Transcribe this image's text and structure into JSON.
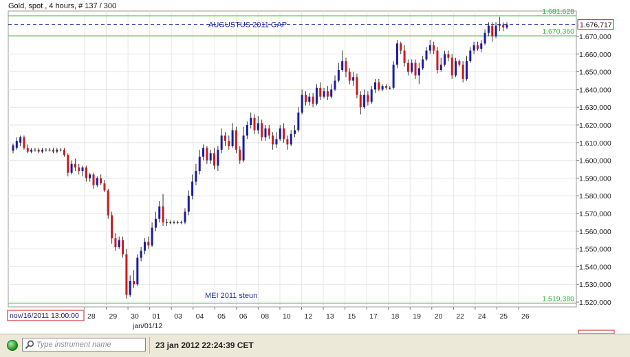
{
  "header": {
    "title": "Gold, spot , 4 hours, # 137 / 300"
  },
  "colors": {
    "up": "#1a1aa6",
    "down": "#cc1a1a",
    "flat": "#1a1a1a",
    "grid": "#e6e6e6",
    "level": "#2bbd2b",
    "dashed": "#1f2f9c",
    "accent": "#cc1a1a"
  },
  "chart_data": {
    "type": "candlestick",
    "title": "Gold, spot , 4 hours, # 137 / 300",
    "y_range": [
      1519380,
      1681628
    ],
    "y_ticks": [
      "1.520,000",
      "1.530,000",
      "1.540,000",
      "1.550,000",
      "1.560,000",
      "1.570,000",
      "1.580,000",
      "1.590,000",
      "1.600,000",
      "1.610,000",
      "1.620,000",
      "1.630,000",
      "1.640,000",
      "1.650,000",
      "1.660,000",
      "1.670,000"
    ],
    "y_tick_values": [
      1520000,
      1530000,
      1540000,
      1550000,
      1560000,
      1570000,
      1580000,
      1590000,
      1600000,
      1610000,
      1620000,
      1630000,
      1640000,
      1650000,
      1660000,
      1670000
    ],
    "x_labels": [
      "28",
      "29",
      "30",
      "01",
      "03",
      "04",
      "05",
      "06",
      "08",
      "10",
      "12",
      "13",
      "15",
      "17",
      "18",
      "19",
      "20",
      "22",
      "24",
      "25",
      "26"
    ],
    "x_sublabel": "jan/01/12",
    "crosshair_date": "nov/16/2011 13:00:00",
    "current_price": "1.676,717",
    "current_value": 1676717,
    "levels": [
      {
        "label": "1.681,628",
        "value": 1681628
      },
      {
        "label": "1.670,360",
        "value": 1670360
      },
      {
        "label": "1.519,380",
        "value": 1519380
      }
    ],
    "annotations": [
      {
        "text": "AUGUSTUS 2011 GAP",
        "value": 1676717
      },
      {
        "text": "MEI 2011 steun",
        "value": 1525000
      }
    ],
    "candles": [
      {
        "o": 1605500,
        "c": 1608500,
        "h": 1609500,
        "l": 1604000
      },
      {
        "o": 1607000,
        "c": 1611000,
        "h": 1613000,
        "l": 1606000
      },
      {
        "o": 1610000,
        "c": 1613000,
        "h": 1614000,
        "l": 1608000
      },
      {
        "o": 1613000,
        "c": 1607000,
        "h": 1614000,
        "l": 1606000
      },
      {
        "o": 1607000,
        "c": 1605000,
        "h": 1609000,
        "l": 1604000
      },
      {
        "o": 1605000,
        "c": 1606000,
        "h": 1607000,
        "l": 1604000
      },
      {
        "o": 1606000,
        "c": 1606000,
        "h": 1607000,
        "l": 1605000
      },
      {
        "o": 1606000,
        "c": 1605000,
        "h": 1607000,
        "l": 1604000
      },
      {
        "o": 1605000,
        "c": 1606000,
        "h": 1607000,
        "l": 1604000
      },
      {
        "o": 1606000,
        "c": 1606000,
        "h": 1607000,
        "l": 1605000
      },
      {
        "o": 1606000,
        "c": 1606000,
        "h": 1607000,
        "l": 1605000
      },
      {
        "o": 1606000,
        "c": 1605000,
        "h": 1607000,
        "l": 1604000
      },
      {
        "o": 1605000,
        "c": 1606000,
        "h": 1607000,
        "l": 1604000
      },
      {
        "o": 1606000,
        "c": 1606000,
        "h": 1607000,
        "l": 1605000
      },
      {
        "o": 1606000,
        "c": 1603000,
        "h": 1607000,
        "l": 1602000
      },
      {
        "o": 1603000,
        "c": 1593000,
        "h": 1604000,
        "l": 1591000
      },
      {
        "o": 1593000,
        "c": 1598000,
        "h": 1600000,
        "l": 1592000
      },
      {
        "o": 1598000,
        "c": 1596000,
        "h": 1601000,
        "l": 1594000
      },
      {
        "o": 1596000,
        "c": 1594000,
        "h": 1598000,
        "l": 1592000
      },
      {
        "o": 1594000,
        "c": 1596000,
        "h": 1597000,
        "l": 1591000
      },
      {
        "o": 1596000,
        "c": 1590000,
        "h": 1597000,
        "l": 1588000
      },
      {
        "o": 1590000,
        "c": 1592000,
        "h": 1593000,
        "l": 1588000
      },
      {
        "o": 1592000,
        "c": 1586000,
        "h": 1593000,
        "l": 1584000
      },
      {
        "o": 1586000,
        "c": 1590000,
        "h": 1591000,
        "l": 1585000
      },
      {
        "o": 1590000,
        "c": 1587000,
        "h": 1592000,
        "l": 1586000
      },
      {
        "o": 1587000,
        "c": 1583000,
        "h": 1589000,
        "l": 1582000
      },
      {
        "o": 1583000,
        "c": 1569000,
        "h": 1584000,
        "l": 1567000
      },
      {
        "o": 1569000,
        "c": 1556000,
        "h": 1571000,
        "l": 1553000
      },
      {
        "o": 1556000,
        "c": 1551000,
        "h": 1559000,
        "l": 1549000
      },
      {
        "o": 1551000,
        "c": 1555000,
        "h": 1557000,
        "l": 1550000
      },
      {
        "o": 1555000,
        "c": 1547000,
        "h": 1557000,
        "l": 1545000
      },
      {
        "o": 1547000,
        "c": 1524000,
        "h": 1550000,
        "l": 1522000
      },
      {
        "o": 1524000,
        "c": 1532000,
        "h": 1535000,
        "l": 1523000
      },
      {
        "o": 1532000,
        "c": 1530000,
        "h": 1538000,
        "l": 1528000
      },
      {
        "o": 1530000,
        "c": 1545000,
        "h": 1547000,
        "l": 1529000
      },
      {
        "o": 1545000,
        "c": 1549000,
        "h": 1551000,
        "l": 1543000
      },
      {
        "o": 1549000,
        "c": 1554000,
        "h": 1556000,
        "l": 1547000
      },
      {
        "o": 1554000,
        "c": 1552000,
        "h": 1557000,
        "l": 1550000
      },
      {
        "o": 1552000,
        "c": 1562000,
        "h": 1565000,
        "l": 1551000
      },
      {
        "o": 1562000,
        "c": 1567000,
        "h": 1571000,
        "l": 1560000
      },
      {
        "o": 1567000,
        "c": 1574000,
        "h": 1577000,
        "l": 1565000
      },
      {
        "o": 1574000,
        "c": 1565000,
        "h": 1581000,
        "l": 1563000
      },
      {
        "o": 1565000,
        "c": 1565000,
        "h": 1567000,
        "l": 1563000
      },
      {
        "o": 1565000,
        "c": 1565000,
        "h": 1566000,
        "l": 1564000
      },
      {
        "o": 1565000,
        "c": 1565000,
        "h": 1566000,
        "l": 1564000
      },
      {
        "o": 1565000,
        "c": 1565000,
        "h": 1566000,
        "l": 1564000
      },
      {
        "o": 1565000,
        "c": 1565000,
        "h": 1566000,
        "l": 1564000
      },
      {
        "o": 1565000,
        "c": 1571000,
        "h": 1573000,
        "l": 1564000
      },
      {
        "o": 1571000,
        "c": 1580000,
        "h": 1583000,
        "l": 1569000
      },
      {
        "o": 1580000,
        "c": 1588000,
        "h": 1592000,
        "l": 1578000
      },
      {
        "o": 1588000,
        "c": 1594000,
        "h": 1598000,
        "l": 1586000
      },
      {
        "o": 1594000,
        "c": 1602000,
        "h": 1606000,
        "l": 1592000
      },
      {
        "o": 1602000,
        "c": 1607000,
        "h": 1609000,
        "l": 1600000
      },
      {
        "o": 1607000,
        "c": 1600000,
        "h": 1608000,
        "l": 1598000
      },
      {
        "o": 1600000,
        "c": 1604000,
        "h": 1606000,
        "l": 1598000
      },
      {
        "o": 1604000,
        "c": 1597000,
        "h": 1607000,
        "l": 1595000
      },
      {
        "o": 1597000,
        "c": 1606000,
        "h": 1608000,
        "l": 1594000
      },
      {
        "o": 1606000,
        "c": 1614000,
        "h": 1618000,
        "l": 1604000
      },
      {
        "o": 1614000,
        "c": 1611000,
        "h": 1616000,
        "l": 1608000
      },
      {
        "o": 1611000,
        "c": 1608000,
        "h": 1614000,
        "l": 1606000
      },
      {
        "o": 1608000,
        "c": 1617000,
        "h": 1621000,
        "l": 1607000
      },
      {
        "o": 1617000,
        "c": 1606000,
        "h": 1619000,
        "l": 1604000
      },
      {
        "o": 1606000,
        "c": 1600000,
        "h": 1608000,
        "l": 1598000
      },
      {
        "o": 1600000,
        "c": 1614000,
        "h": 1619000,
        "l": 1599000
      },
      {
        "o": 1614000,
        "c": 1620000,
        "h": 1622000,
        "l": 1612000
      },
      {
        "o": 1620000,
        "c": 1624000,
        "h": 1627000,
        "l": 1618000
      },
      {
        "o": 1624000,
        "c": 1617000,
        "h": 1626000,
        "l": 1615000
      },
      {
        "o": 1617000,
        "c": 1621000,
        "h": 1625000,
        "l": 1615000
      },
      {
        "o": 1621000,
        "c": 1613000,
        "h": 1623000,
        "l": 1611000
      },
      {
        "o": 1613000,
        "c": 1618000,
        "h": 1620000,
        "l": 1611000
      },
      {
        "o": 1618000,
        "c": 1614000,
        "h": 1620000,
        "l": 1612000
      },
      {
        "o": 1614000,
        "c": 1609000,
        "h": 1616000,
        "l": 1606000
      },
      {
        "o": 1609000,
        "c": 1612000,
        "h": 1616000,
        "l": 1607000
      },
      {
        "o": 1612000,
        "c": 1618000,
        "h": 1620000,
        "l": 1611000
      },
      {
        "o": 1618000,
        "c": 1612000,
        "h": 1621000,
        "l": 1610000
      },
      {
        "o": 1612000,
        "c": 1609000,
        "h": 1614000,
        "l": 1606000
      },
      {
        "o": 1609000,
        "c": 1615000,
        "h": 1617000,
        "l": 1608000
      },
      {
        "o": 1615000,
        "c": 1617000,
        "h": 1620000,
        "l": 1613000
      },
      {
        "o": 1617000,
        "c": 1627000,
        "h": 1630000,
        "l": 1616000
      },
      {
        "o": 1627000,
        "c": 1637000,
        "h": 1640000,
        "l": 1626000
      },
      {
        "o": 1637000,
        "c": 1633000,
        "h": 1639000,
        "l": 1631000
      },
      {
        "o": 1633000,
        "c": 1636000,
        "h": 1638000,
        "l": 1631000
      },
      {
        "o": 1636000,
        "c": 1632000,
        "h": 1638000,
        "l": 1630000
      },
      {
        "o": 1632000,
        "c": 1641000,
        "h": 1643000,
        "l": 1631000
      },
      {
        "o": 1641000,
        "c": 1636000,
        "h": 1644000,
        "l": 1634000
      },
      {
        "o": 1636000,
        "c": 1639000,
        "h": 1641000,
        "l": 1635000
      },
      {
        "o": 1639000,
        "c": 1636000,
        "h": 1642000,
        "l": 1634000
      },
      {
        "o": 1636000,
        "c": 1640000,
        "h": 1643000,
        "l": 1635000
      },
      {
        "o": 1640000,
        "c": 1645000,
        "h": 1648000,
        "l": 1639000
      },
      {
        "o": 1645000,
        "c": 1651000,
        "h": 1655000,
        "l": 1644000
      },
      {
        "o": 1651000,
        "c": 1656000,
        "h": 1662000,
        "l": 1650000
      },
      {
        "o": 1656000,
        "c": 1650000,
        "h": 1658000,
        "l": 1647000
      },
      {
        "o": 1650000,
        "c": 1645000,
        "h": 1652000,
        "l": 1643000
      },
      {
        "o": 1645000,
        "c": 1647000,
        "h": 1650000,
        "l": 1642000
      },
      {
        "o": 1647000,
        "c": 1637000,
        "h": 1649000,
        "l": 1635000
      },
      {
        "o": 1637000,
        "c": 1630000,
        "h": 1639000,
        "l": 1626000
      },
      {
        "o": 1630000,
        "c": 1637000,
        "h": 1640000,
        "l": 1629000
      },
      {
        "o": 1637000,
        "c": 1633000,
        "h": 1639000,
        "l": 1631000
      },
      {
        "o": 1633000,
        "c": 1640000,
        "h": 1642000,
        "l": 1632000
      },
      {
        "o": 1640000,
        "c": 1644000,
        "h": 1646000,
        "l": 1638000
      },
      {
        "o": 1644000,
        "c": 1640000,
        "h": 1646000,
        "l": 1639000
      },
      {
        "o": 1640000,
        "c": 1642000,
        "h": 1643000,
        "l": 1639000
      },
      {
        "o": 1642000,
        "c": 1641000,
        "h": 1643000,
        "l": 1640000
      },
      {
        "o": 1641000,
        "c": 1641000,
        "h": 1642000,
        "l": 1640000
      },
      {
        "o": 1641000,
        "c": 1654000,
        "h": 1656000,
        "l": 1640000
      },
      {
        "o": 1654000,
        "c": 1666000,
        "h": 1668000,
        "l": 1652000
      },
      {
        "o": 1666000,
        "c": 1662000,
        "h": 1667000,
        "l": 1660000
      },
      {
        "o": 1662000,
        "c": 1655000,
        "h": 1665000,
        "l": 1653000
      },
      {
        "o": 1655000,
        "c": 1650000,
        "h": 1657000,
        "l": 1648000
      },
      {
        "o": 1650000,
        "c": 1655000,
        "h": 1657000,
        "l": 1649000
      },
      {
        "o": 1655000,
        "c": 1648000,
        "h": 1657000,
        "l": 1646000
      },
      {
        "o": 1648000,
        "c": 1652000,
        "h": 1655000,
        "l": 1643000
      },
      {
        "o": 1652000,
        "c": 1657000,
        "h": 1659000,
        "l": 1651000
      },
      {
        "o": 1657000,
        "c": 1662000,
        "h": 1664000,
        "l": 1656000
      },
      {
        "o": 1662000,
        "c": 1665000,
        "h": 1668000,
        "l": 1660000
      },
      {
        "o": 1665000,
        "c": 1662000,
        "h": 1667000,
        "l": 1660000
      },
      {
        "o": 1662000,
        "c": 1651000,
        "h": 1664000,
        "l": 1649000
      },
      {
        "o": 1651000,
        "c": 1654000,
        "h": 1658000,
        "l": 1650000
      },
      {
        "o": 1654000,
        "c": 1660000,
        "h": 1662000,
        "l": 1653000
      },
      {
        "o": 1660000,
        "c": 1658000,
        "h": 1662000,
        "l": 1656000
      },
      {
        "o": 1658000,
        "c": 1648000,
        "h": 1660000,
        "l": 1646000
      },
      {
        "o": 1648000,
        "c": 1656000,
        "h": 1658000,
        "l": 1647000
      },
      {
        "o": 1656000,
        "c": 1654000,
        "h": 1657000,
        "l": 1653000
      },
      {
        "o": 1654000,
        "c": 1646000,
        "h": 1656000,
        "l": 1644000
      },
      {
        "o": 1646000,
        "c": 1656000,
        "h": 1659000,
        "l": 1645000
      },
      {
        "o": 1656000,
        "c": 1662000,
        "h": 1664000,
        "l": 1655000
      },
      {
        "o": 1662000,
        "c": 1665000,
        "h": 1667000,
        "l": 1660000
      },
      {
        "o": 1665000,
        "c": 1663000,
        "h": 1667000,
        "l": 1662000
      },
      {
        "o": 1663000,
        "c": 1666000,
        "h": 1668000,
        "l": 1661000
      },
      {
        "o": 1666000,
        "c": 1672000,
        "h": 1674000,
        "l": 1665000
      },
      {
        "o": 1672000,
        "c": 1676000,
        "h": 1678000,
        "l": 1670000
      },
      {
        "o": 1676000,
        "c": 1670000,
        "h": 1678000,
        "l": 1667000
      },
      {
        "o": 1670000,
        "c": 1676000,
        "h": 1678000,
        "l": 1669000
      },
      {
        "o": 1676000,
        "c": 1676500,
        "h": 1681000,
        "l": 1673000
      },
      {
        "o": 1676500,
        "c": 1675000,
        "h": 1678000,
        "l": 1673000
      },
      {
        "o": 1675000,
        "c": 1676717,
        "h": 1678000,
        "l": 1674000
      }
    ]
  },
  "statusbar": {
    "search_placeholder": "Type instrument name",
    "datetime": "23 jan 2012 22:24:39 CET"
  }
}
